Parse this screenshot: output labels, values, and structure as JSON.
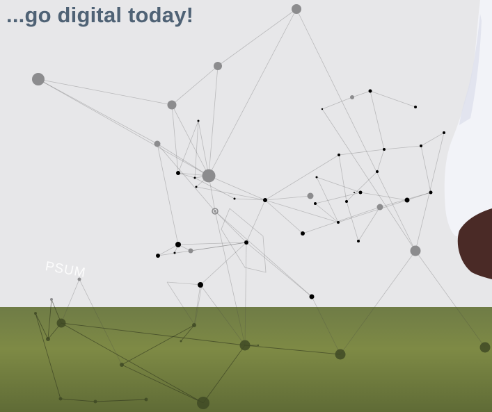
{
  "banner": {
    "headline": "...go digital today!",
    "watermark": "PSUM"
  },
  "colors": {
    "headline": "#4f6275",
    "top_background": "#e7e7e9",
    "grey_node": "#8a8a8c",
    "black_node": "#000000"
  }
}
